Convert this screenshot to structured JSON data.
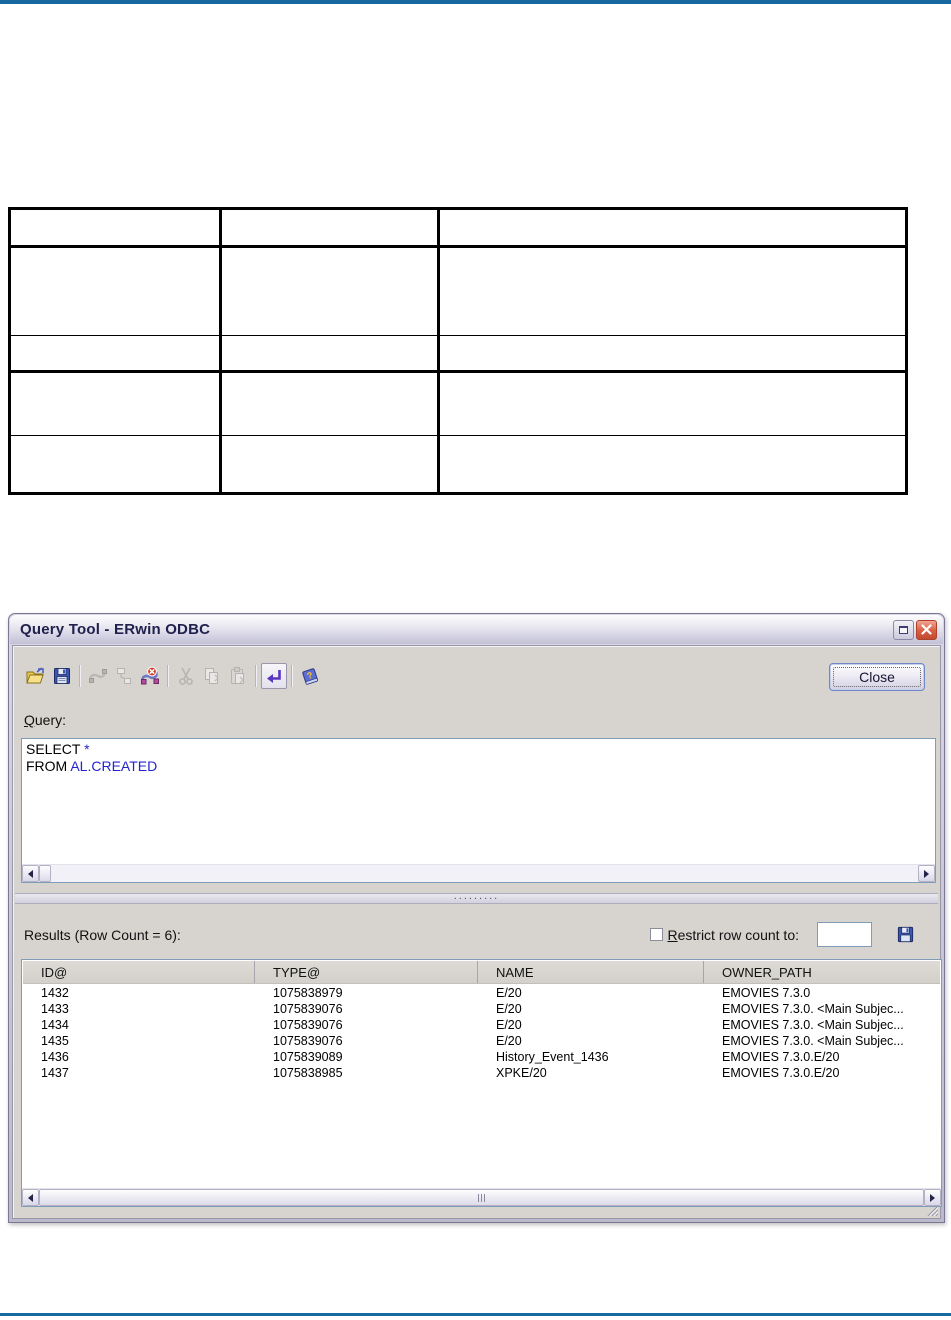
{
  "page": {
    "rule_color": "#1769a0"
  },
  "doc_table": {
    "rows": [
      [
        "",
        "",
        ""
      ],
      [
        "",
        "",
        ""
      ],
      [
        "",
        "",
        ""
      ],
      [
        "",
        "",
        ""
      ],
      [
        "",
        "",
        ""
      ]
    ]
  },
  "window": {
    "title": "Query Tool - ERwin ODBC",
    "close_button_label": "Close",
    "toolbar_icons": [
      "open-icon",
      "save-icon",
      "link-icon",
      "entities-icon",
      "disconnect-icon",
      "cut-icon",
      "copy-icon",
      "paste-icon",
      "execute-icon",
      "help-icon"
    ],
    "query": {
      "label_mnemonic": "Q",
      "label_rest": "uery:",
      "lines": [
        {
          "keyword": "SELECT ",
          "value": "*"
        },
        {
          "keyword": "FROM ",
          "value": "AL.CREATED"
        }
      ]
    },
    "splitter_dots": ".........",
    "results": {
      "label": "Results (Row Count = 6):",
      "restrict_mnemonic": "R",
      "restrict_rest": "estrict row count to:",
      "restrict_value": "",
      "columns": [
        "ID@",
        "TYPE@",
        "NAME",
        "OWNER_PATH"
      ],
      "rows": [
        [
          "1432",
          "1075838979",
          "E/20",
          "EMOVIES 7.3.0"
        ],
        [
          "1433",
          "1075839076",
          "E/20",
          "EMOVIES 7.3.0. <Main Subjec..."
        ],
        [
          "1434",
          "1075839076",
          "E/20",
          "EMOVIES 7.3.0. <Main Subjec..."
        ],
        [
          "1435",
          "1075839076",
          "E/20",
          "EMOVIES 7.3.0. <Main Subjec..."
        ],
        [
          "1436",
          "1075839089",
          "History_Event_1436",
          "EMOVIES 7.3.0.E/20"
        ],
        [
          "1437",
          "1075838985",
          "XPKE/20",
          "EMOVIES 7.3.0.E/20"
        ]
      ]
    }
  }
}
